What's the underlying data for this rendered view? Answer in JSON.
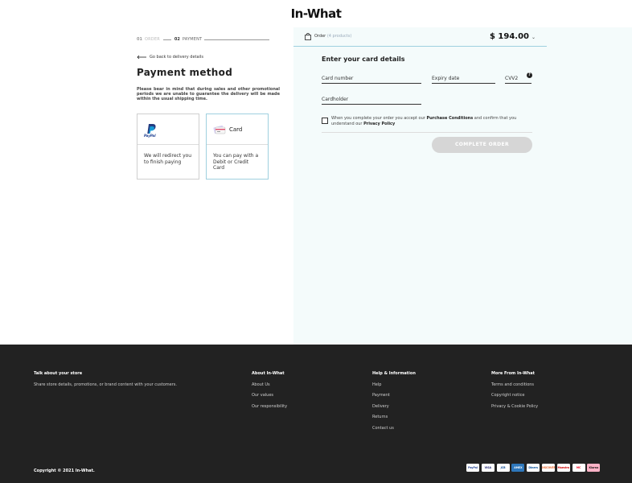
{
  "brand": {
    "logo": "In-What"
  },
  "steps": [
    {
      "num": "01",
      "label": "ORDER",
      "active": false
    },
    {
      "num": "02",
      "label": "PAYMENT",
      "active": true
    }
  ],
  "back_link": "Go back to delivery details",
  "payment_method": {
    "title": "Payment method",
    "note": "Please bear in mind that during sales and other promotional periods we are unable to guarantee the delivery will be made within the usual shipping time.",
    "options": [
      {
        "name": "",
        "logo_text": "PayPal",
        "description": "We will redirect you to finish paying",
        "selected": false
      },
      {
        "name": "Card",
        "description": "You can pay with a Debit or Credit Card",
        "selected": true
      }
    ]
  },
  "order": {
    "label": "Order",
    "count": "(4 products)",
    "total": "$ 194.00"
  },
  "card_form": {
    "heading": "Enter your card details",
    "card_number": "Card number",
    "expiry": "Expiry date",
    "cvv": "CVV2",
    "help": "?",
    "cardholder": "Cardholder"
  },
  "consent": {
    "text_1": "When you complete your order you accept our ",
    "link_1": "Purchase Conditions",
    "text_2": " and confirm that you understand our ",
    "link_2": "Privacy Policy"
  },
  "complete_button": "COMPLETE ORDER",
  "footer": {
    "columns": [
      {
        "heading": "Talk about your store",
        "items": [
          "Share store details, promotions, or brand content with your customers."
        ]
      },
      {
        "heading": "About In-What",
        "items": [
          "About Us",
          "Our values",
          "Our responsibility"
        ]
      },
      {
        "heading": "Help & Information",
        "items": [
          "Help",
          "Payment",
          "Delivery",
          "Returns",
          "Contact us"
        ]
      },
      {
        "heading": "More From In-What",
        "items": [
          "Terms and conditions",
          "Copyright notice",
          "Privacy & Cookie Policy"
        ]
      }
    ],
    "copyright": "Copyright © 2021 In-What.",
    "payment_icons": [
      {
        "label": "PayPal",
        "bg": "#ffffff",
        "fg": "#1d3d8f"
      },
      {
        "label": "VISA",
        "bg": "#ffffff",
        "fg": "#1a1f71"
      },
      {
        "label": "JCB",
        "bg": "#ffffff",
        "fg": "#0e4c96"
      },
      {
        "label": "AMEX",
        "bg": "#2e77bb",
        "fg": "#ffffff"
      },
      {
        "label": "Diners",
        "bg": "#ffffff",
        "fg": "#004a97"
      },
      {
        "label": "DISCOVER",
        "bg": "#ffffff",
        "fg": "#e55c20"
      },
      {
        "label": "Maestro",
        "bg": "#ffffff",
        "fg": "#cc0000"
      },
      {
        "label": "MC",
        "bg": "#ffffff",
        "fg": "#eb001b"
      },
      {
        "label": "Klarna",
        "bg": "#ffb3c7",
        "fg": "#111111"
      }
    ]
  },
  "colors": {
    "accent": "#9fd0df",
    "panel": "#f4fbfb",
    "footer": "#222222",
    "button_disabled": "#d6d6d6"
  }
}
